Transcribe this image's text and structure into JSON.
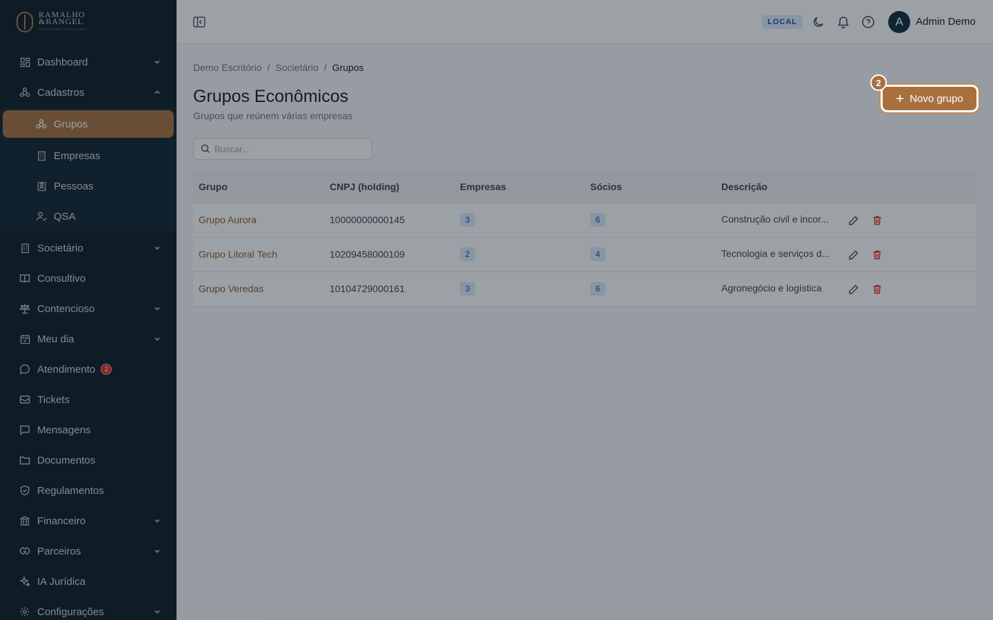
{
  "brand": {
    "line1": "RAMALHO",
    "line2": "&RANGEL",
    "tagline": "ADVOGADOS ASSOCIADOS"
  },
  "sidebar": {
    "items": [
      {
        "label": "Dashboard",
        "icon": "dashboard-icon",
        "expandable": true
      },
      {
        "label": "Cadastros",
        "icon": "network-icon",
        "expandable": true,
        "expanded": true,
        "children": [
          {
            "label": "Grupos",
            "icon": "network-icon",
            "active": true
          },
          {
            "label": "Empresas",
            "icon": "building-icon"
          },
          {
            "label": "Pessoas",
            "icon": "id-badge-icon"
          },
          {
            "label": "QSA",
            "icon": "user-check-icon"
          }
        ]
      },
      {
        "label": "Societário",
        "icon": "building-icon",
        "expandable": true
      },
      {
        "label": "Consultivo",
        "icon": "book-icon"
      },
      {
        "label": "Contencioso",
        "icon": "scale-icon",
        "expandable": true
      },
      {
        "label": "Meu dia",
        "icon": "calendar-icon",
        "expandable": true
      },
      {
        "label": "Atendimento",
        "icon": "chat-bubble-icon",
        "badge": "2"
      },
      {
        "label": "Tickets",
        "icon": "ticket-icon"
      },
      {
        "label": "Mensagens",
        "icon": "message-icon"
      },
      {
        "label": "Documentos",
        "icon": "folder-icon"
      },
      {
        "label": "Regulamentos",
        "icon": "shield-icon"
      },
      {
        "label": "Financeiro",
        "icon": "bank-icon",
        "expandable": true
      },
      {
        "label": "Parceiros",
        "icon": "handshake-icon",
        "expandable": true
      },
      {
        "label": "IA Jurídica",
        "icon": "sparkle-icon"
      },
      {
        "label": "Configurações",
        "icon": "gear-icon",
        "expandable": true
      }
    ]
  },
  "header": {
    "env": "LOCAL",
    "user": {
      "initial": "A",
      "name": "Admin Demo"
    }
  },
  "breadcrumb": [
    "Demo Escritório",
    "Societário",
    "Grupos"
  ],
  "page": {
    "title": "Grupos Econômicos",
    "subtitle": "Grupos que reúnem várias empresas",
    "new_button": "Novo grupo",
    "step": "2"
  },
  "search": {
    "placeholder": "Buscar...",
    "value": ""
  },
  "table": {
    "columns": [
      "Grupo",
      "CNPJ (holding)",
      "Empresas",
      "Sócios",
      "Descrição"
    ],
    "rows": [
      {
        "grupo": "Grupo Aurora",
        "cnpj": "10000000000145",
        "empresas": "3",
        "socios": "6",
        "descricao": "Construção civil e incor..."
      },
      {
        "grupo": "Grupo Litoral Tech",
        "cnpj": "10209458000109",
        "empresas": "2",
        "socios": "4",
        "descricao": "Tecnologia e serviços d..."
      },
      {
        "grupo": "Grupo Veredas",
        "cnpj": "10104729000161",
        "empresas": "3",
        "socios": "6",
        "descricao": "Agronegócio e logística"
      }
    ]
  },
  "colors": {
    "accent": "#a8703f",
    "sidebar": "#0b1a24",
    "danger": "#dc2626",
    "info_bg": "#dbeafe"
  }
}
